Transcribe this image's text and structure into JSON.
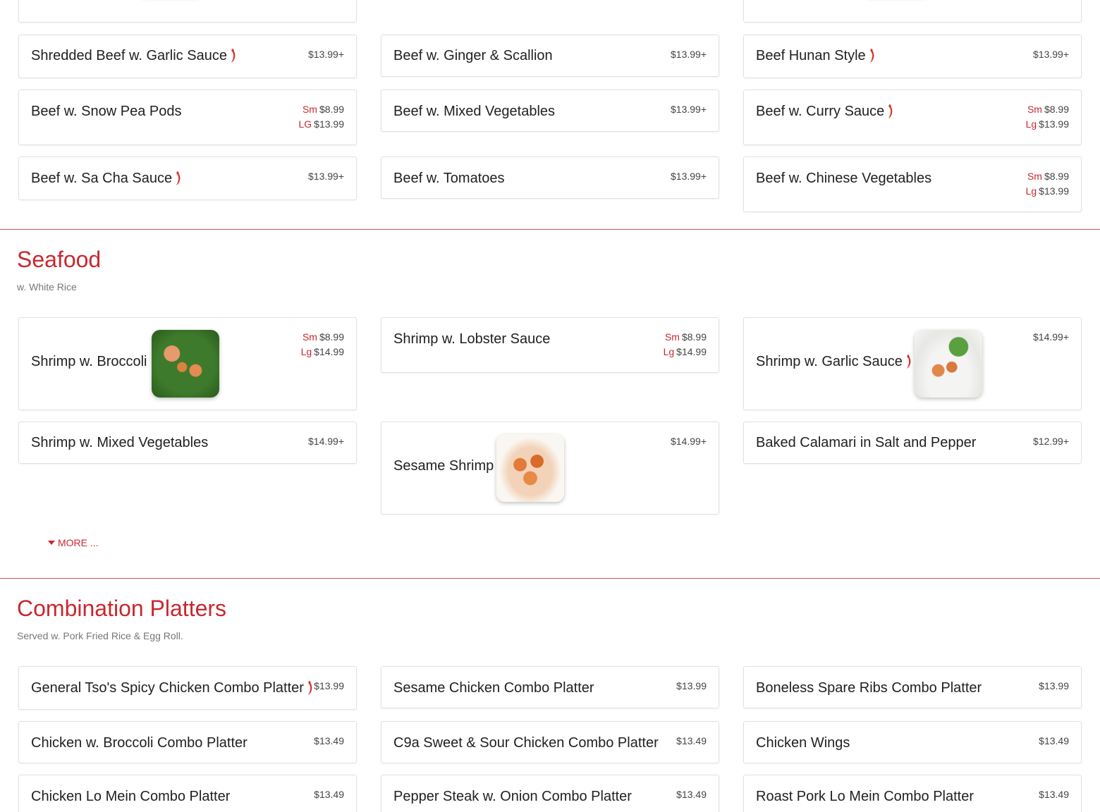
{
  "beef": {
    "items": [
      {
        "name": "Shredded Beef w. Garlic Sauce",
        "spicy": true,
        "price": "$13.99+"
      },
      {
        "name": "Beef w. Ginger & Scallion",
        "spicy": false,
        "price": "$13.99+"
      },
      {
        "name": "Beef Hunan Style",
        "spicy": true,
        "price": "$13.99+"
      },
      {
        "name": "Beef w. Snow Pea Pods",
        "spicy": false,
        "sizes": [
          {
            "label": "Sm",
            "price": "$8.99"
          },
          {
            "label": "LG",
            "price": "$13.99"
          }
        ]
      },
      {
        "name": "Beef w. Mixed Vegetables",
        "spicy": false,
        "price": "$13.99+"
      },
      {
        "name": "Beef w. Curry Sauce",
        "spicy": true,
        "sizes": [
          {
            "label": "Sm",
            "price": "$8.99"
          },
          {
            "label": "Lg",
            "price": "$13.99"
          }
        ]
      },
      {
        "name": "Beef w. Sa Cha Sauce",
        "spicy": true,
        "price": "$13.99+"
      },
      {
        "name": "Beef w. Tomatoes",
        "spicy": false,
        "price": "$13.99+"
      },
      {
        "name": "Beef w. Chinese Vegetables",
        "spicy": false,
        "sizes": [
          {
            "label": "Sm",
            "price": "$8.99"
          },
          {
            "label": "Lg",
            "price": "$13.99"
          }
        ]
      }
    ]
  },
  "seafood": {
    "title": "Seafood",
    "subtitle": "w. White Rice",
    "more_label": "MORE ...",
    "items": [
      {
        "name": "Shrimp w. Broccoli",
        "spicy": false,
        "has_image": true,
        "sizes": [
          {
            "label": "Sm",
            "price": "$8.99"
          },
          {
            "label": "Lg",
            "price": "$14.99"
          }
        ]
      },
      {
        "name": "Shrimp w. Lobster Sauce",
        "spicy": false,
        "sizes": [
          {
            "label": "Sm",
            "price": "$8.99"
          },
          {
            "label": "Lg",
            "price": "$14.99"
          }
        ]
      },
      {
        "name": "Shrimp w. Garlic Sauce",
        "spicy": true,
        "has_image": true,
        "price": "$14.99+"
      },
      {
        "name": "Shrimp w. Mixed Vegetables",
        "spicy": false,
        "price": "$14.99+"
      },
      {
        "name": "Sesame Shrimp",
        "spicy": false,
        "has_image": true,
        "price": "$14.99+"
      },
      {
        "name": "Baked Calamari in Salt and Pepper",
        "spicy": false,
        "price": "$12.99+"
      }
    ]
  },
  "combo": {
    "title": "Combination Platters",
    "subtitle": "Served w. Pork Fried Rice & Egg Roll.",
    "items": [
      {
        "name": "General Tso's Spicy Chicken Combo Platter",
        "spicy": true,
        "price": "$13.99"
      },
      {
        "name": "Sesame Chicken Combo Platter",
        "spicy": false,
        "price": "$13.99"
      },
      {
        "name": "Boneless Spare Ribs Combo Platter",
        "spicy": false,
        "price": "$13.99"
      },
      {
        "name": "Chicken w. Broccoli Combo Platter",
        "spicy": false,
        "price": "$13.49"
      },
      {
        "name": "C9a Sweet & Sour Chicken Combo Platter",
        "spicy": false,
        "price": "$13.49"
      },
      {
        "name": "Chicken Wings",
        "spicy": false,
        "price": "$13.49"
      },
      {
        "name": "Chicken Lo Mein Combo Platter",
        "spicy": false,
        "price": "$13.49"
      },
      {
        "name": "Pepper Steak w. Onion Combo Platter",
        "spicy": false,
        "price": "$13.49"
      },
      {
        "name": "Roast Pork Lo Mein Combo Platter",
        "spicy": false,
        "price": "$13.49"
      }
    ]
  },
  "colors": {
    "accent": "#c8282f",
    "pepper": "#d7342a"
  }
}
